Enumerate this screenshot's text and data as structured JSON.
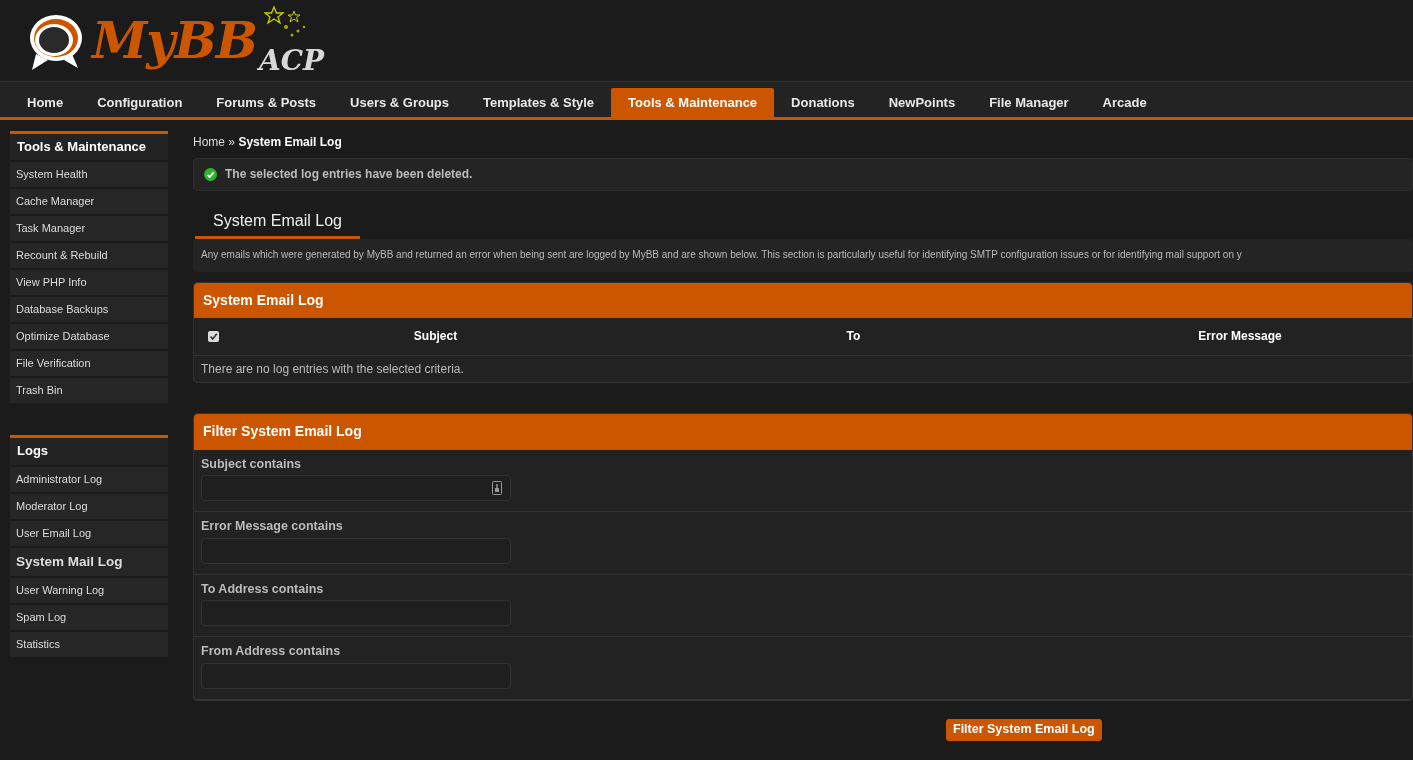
{
  "logo": {
    "name": "MyBB",
    "sub": "ACP"
  },
  "nav": [
    {
      "label": "Home",
      "selected": false
    },
    {
      "label": "Configuration",
      "selected": false
    },
    {
      "label": "Forums & Posts",
      "selected": false
    },
    {
      "label": "Users & Groups",
      "selected": false
    },
    {
      "label": "Templates & Style",
      "selected": false
    },
    {
      "label": "Tools & Maintenance",
      "selected": true
    },
    {
      "label": "Donations",
      "selected": false
    },
    {
      "label": "NewPoints",
      "selected": false
    },
    {
      "label": "File Manager",
      "selected": false
    },
    {
      "label": "Arcade",
      "selected": false
    }
  ],
  "sidebar": [
    {
      "title": "Tools & Maintenance",
      "items": [
        {
          "label": "System Health",
          "selected": false
        },
        {
          "label": "Cache Manager",
          "selected": false
        },
        {
          "label": "Task Manager",
          "selected": false
        },
        {
          "label": "Recount & Rebuild",
          "selected": false
        },
        {
          "label": "View PHP Info",
          "selected": false
        },
        {
          "label": "Database Backups",
          "selected": false
        },
        {
          "label": "Optimize Database",
          "selected": false
        },
        {
          "label": "File Verification",
          "selected": false
        },
        {
          "label": "Trash Bin",
          "selected": false
        }
      ]
    },
    {
      "title": "Logs",
      "items": [
        {
          "label": "Administrator Log",
          "selected": false
        },
        {
          "label": "Moderator Log",
          "selected": false
        },
        {
          "label": "User Email Log",
          "selected": false
        },
        {
          "label": "System Mail Log",
          "selected": true
        },
        {
          "label": "User Warning Log",
          "selected": false
        },
        {
          "label": "Spam Log",
          "selected": false
        },
        {
          "label": "Statistics",
          "selected": false
        }
      ]
    }
  ],
  "breadcrumb": {
    "home": "Home",
    "sep": "»",
    "current": "System Email Log"
  },
  "alert": "The selected log entries have been deleted.",
  "page_tab": "System Email Log",
  "description": "Any emails which were generated by MyBB and returned an error when being sent are logged by MyBB and are shown below. This section is particularly useful for identifying SMTP configuration issues or for identifying mail support on y",
  "log_table": {
    "title": "System Email Log",
    "select_all_checked": true,
    "columns": [
      "Subject",
      "To",
      "Error Message"
    ],
    "empty": "There are no log entries with the selected criteria."
  },
  "filter": {
    "title": "Filter System Email Log",
    "fields": [
      {
        "label": "Subject contains",
        "icon": true
      },
      {
        "label": "Error Message contains",
        "icon": false
      },
      {
        "label": "To Address contains",
        "icon": false
      },
      {
        "label": "From Address contains",
        "icon": false
      }
    ],
    "button": "Filter System Email Log"
  }
}
